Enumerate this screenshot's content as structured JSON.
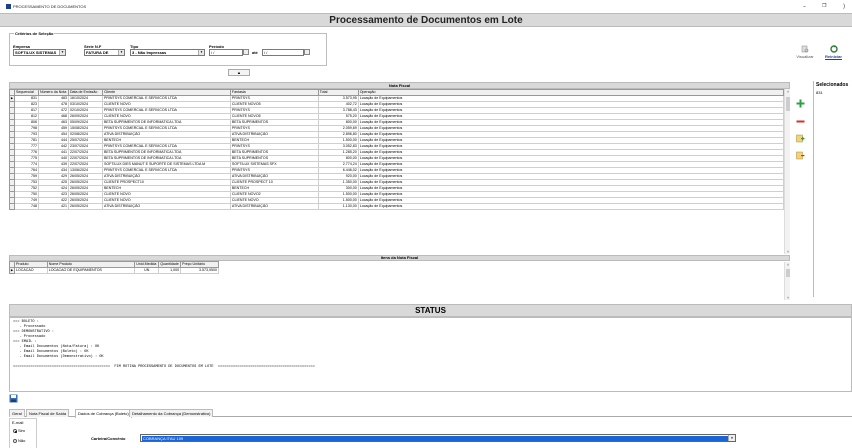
{
  "window": {
    "title": "PROCESSAMENTO DE DOCUMENTOS",
    "minimize": "–",
    "restore": "❐",
    "close": "⟩"
  },
  "banner": {
    "title": "Processamento de Documentos em Lote"
  },
  "criteria": {
    "legend": "Critérios de Seleção",
    "empresa_label": "Empresa",
    "empresa_value": "SOFTILUX SISTEMAS",
    "serie_label": "Série N.F",
    "serie_value": "FATURA DE",
    "tipo_label": "Tipo",
    "tipo_value": "3 - Não Impressas",
    "periodo_label": "Período",
    "periodo_start": "/ /",
    "ate_label": "até",
    "periodo_end": "/ /"
  },
  "collapse_button": "▲",
  "right_tools": {
    "visualizar": "Visualizar",
    "reiniciar": "Reiniciar"
  },
  "nota_fiscal": {
    "section_title": "Nota Fiscal",
    "columns": [
      "Sequencial",
      "Número da Nota",
      "Data de Emissão",
      "Cliente",
      "Fantasia",
      "Total",
      "Operação"
    ],
    "rows": [
      [
        "831",
        "483",
        "16/10/2024",
        "PRINTSYS COMERCIAL E SERVICOS LTDA",
        "PRINTSYS",
        "3.573,95",
        "Locação de Equipamentos"
      ],
      [
        "823",
        "478",
        "03/10/2024",
        "CLIENTE NOVO",
        "CLIENTE NOVO5",
        "402,72",
        "Locação de Equipamentos"
      ],
      [
        "817",
        "472",
        "02/10/2024",
        "PRINTSYS COMERCIAL E SERVICOS LTDA",
        "PRINTSYS",
        "3.788,43",
        "Locação de Equipamentos"
      ],
      [
        "812",
        "468",
        "26/09/2024",
        "CLIENTE NOVO",
        "CLIENTE NOVO5",
        "575,20",
        "Locação de Equipamentos"
      ],
      [
        "806",
        "463",
        "05/09/2024",
        "BETA SUPRIMENTOS DE INFORMATICA LTDA",
        "BETA SUPRIMENTOS",
        "800,00",
        "Locação de Equipamentos"
      ],
      [
        "798",
        "459",
        "15/08/2024",
        "PRINTSYS COMERCIAL E SERVICOS LTDA",
        "PRINTSYS",
        "2.059,69",
        "Locação de Equipamentos"
      ],
      [
        "793",
        "454",
        "02/08/2024",
        "ATIVA DISTRIBUIÇÃO",
        "ATIVA DISTRIBUIÇÃO",
        "2.896,80",
        "Locação de Equipamentos"
      ],
      [
        "781",
        "444",
        "25/07/2024",
        "BENTECH",
        "BENTECH",
        "1.500,00",
        "Locação de Equipamentos"
      ],
      [
        "777",
        "442",
        "23/07/2024",
        "PRINTSYS COMERCIAL E SERVICOS LTDA",
        "PRINTSYS",
        "3.052,83",
        "Locação de Equipamentos"
      ],
      [
        "776",
        "441",
        "22/07/2024",
        "BETA SUPRIMENTOS DE INFORMATICA LTDA",
        "BETA SUPRIMENTOS",
        "1.285,20",
        "Locação de Equipamentos"
      ],
      [
        "775",
        "440",
        "22/07/2024",
        "BETA SUPRIMENTOS DE INFORMATICA LTDA",
        "BETA SUPRIMENTOS",
        "800,00",
        "Locação de Equipamentos"
      ],
      [
        "774",
        "439",
        "22/07/2024",
        "SOFTILUX DIES MANUT E SUPORTE DE SISTEMAS LTDA M",
        "SOFTILUX SISTEMAS SFX",
        "2.774,24",
        "Locação de Equipamentos"
      ],
      [
        "764",
        "434",
        "13/06/2024",
        "PRINTSYS COMERCIAL E SERVICOS LTDA",
        "PRINTSYS",
        "6.446,02",
        "Locação de Equipamentos"
      ],
      [
        "759",
        "429",
        "26/05/2024",
        "ATIVA DISTRIBUIÇÃO",
        "ATIVA DISTRIBUIÇÃO",
        "920,00",
        "Locação de Equipamentos"
      ],
      [
        "753",
        "425",
        "26/05/2024",
        "CLIENTE PROSPECT10",
        "CLIENTE PROSPECT 10",
        "1.350,00",
        "Locação de Equipamentos"
      ],
      [
        "752",
        "424",
        "26/05/2024",
        "BENTECH",
        "BENTECH",
        "300,00",
        "Locação de Equipamentos"
      ],
      [
        "750",
        "423",
        "26/05/2024",
        "CLIENTE NOVO",
        "CLIENTE NOVO2",
        "1.500,00",
        "Locação de Equipamentos"
      ],
      [
        "749",
        "422",
        "26/05/2024",
        "CLIENTE NOVO",
        "CLIENTE NOVO",
        "1.500,00",
        "Locação de Equipamentos"
      ],
      [
        "748",
        "421",
        "26/05/2024",
        "ATIVA DISTRIBUIÇÃO",
        "ATIVA DISTRIBUIÇÃO",
        "1.130,00",
        "Locação de Equipamentos"
      ]
    ]
  },
  "itens": {
    "section_title": "Itens da Nota Fiscal",
    "columns": [
      "Produto",
      "Nome Produto",
      "Unid.Medida",
      "Quantidade",
      "Preço Unitário"
    ],
    "rows": [
      [
        "LOCACAO",
        "LOCACAO DE EQUIPAMENTOS",
        "UN",
        "1,000",
        "3.573,9500"
      ]
    ]
  },
  "selecionados": {
    "header": "Selecionados",
    "value": "831"
  },
  "status": {
    "title": "STATUS",
    "lines": [
      "=== BOLETO :",
      "   - Processado",
      "=== DEMONSTRATIVO :",
      "   - Processado",
      "=== EMAIL :",
      "   - Email Documentos (Nota/Fatura) : OK",
      "   - Email Documentos (Boleto) : OK",
      "   - Email Documentos (Demonstrativo) : OK",
      "",
      "=============================================  FIM ROTINA PROCESSAMENTO DE DOCUMENTOS EM LOTE  ============================================="
    ]
  },
  "tabs": [
    "Geral",
    "Nota Fiscal de Saída",
    "Dados de Cobrança (Boleto)",
    "Detalhamento da Cobrança (Demonstrativo)"
  ],
  "email_group": {
    "legend": "E-mail",
    "sim": "Sim",
    "nao": "Não"
  },
  "convenio": {
    "label": "Carteira/Convênio",
    "value": "COBRANÇA ITAU 109"
  },
  "colors": {
    "selection": "#1a64d6",
    "banner": "#d9d9d9",
    "add": "#2ea043",
    "remove": "#d93025"
  },
  "icons": [
    "app-icon",
    "visualizar-icon",
    "reiniciar-icon",
    "add-icon",
    "remove-icon",
    "add-all-icon",
    "remove-all-icon",
    "save-icon"
  ]
}
